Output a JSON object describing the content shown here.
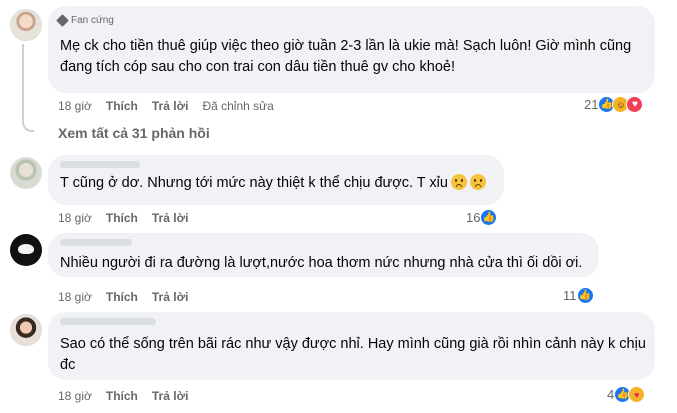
{
  "comments": [
    {
      "badge": "Fan cứng",
      "text": "Mẹ ck cho tiền thuê giúp việc theo giờ tuần 2-3 lần là ukie mà! Sạch luôn! Giờ mình cũng đang tích cóp sau cho con trai con dâu tiền thuê gv cho khoẻ!",
      "time": "18 giờ",
      "like": "Thích",
      "reply": "Trả lời",
      "edited": "Đã chỉnh sửa",
      "reaction_count": "21",
      "reactions": [
        "like-icon",
        "haha-icon",
        "heart-icon"
      ]
    },
    {
      "text": "T cũng ở dơ. Nhưng tới mức này thiệt k thể chịu được. T xỉu",
      "time": "18 giờ",
      "like": "Thích",
      "reply": "Trả lời",
      "reaction_count": "16",
      "reactions": [
        "like-icon"
      ]
    },
    {
      "text": "Nhiều người đi ra đường là lượt,nước hoa thơm nức nhưng nhà cửa thì ối dồi ơi.",
      "time": "18 giờ",
      "like": "Thích",
      "reply": "Trả lời",
      "reaction_count": "11",
      "reactions": [
        "like-icon"
      ]
    },
    {
      "text": "Sao có thể sống trên bãi rác như vậy được nhỉ. Hay mình cũng già rồi nhìn cảnh này k chịu đc",
      "time": "18 giờ",
      "like": "Thích",
      "reply": "Trả lời",
      "reaction_count": "4",
      "reactions": [
        "like-icon",
        "care-icon"
      ]
    }
  ],
  "view_all_replies": "Xem tất cả 31 phản hồi"
}
